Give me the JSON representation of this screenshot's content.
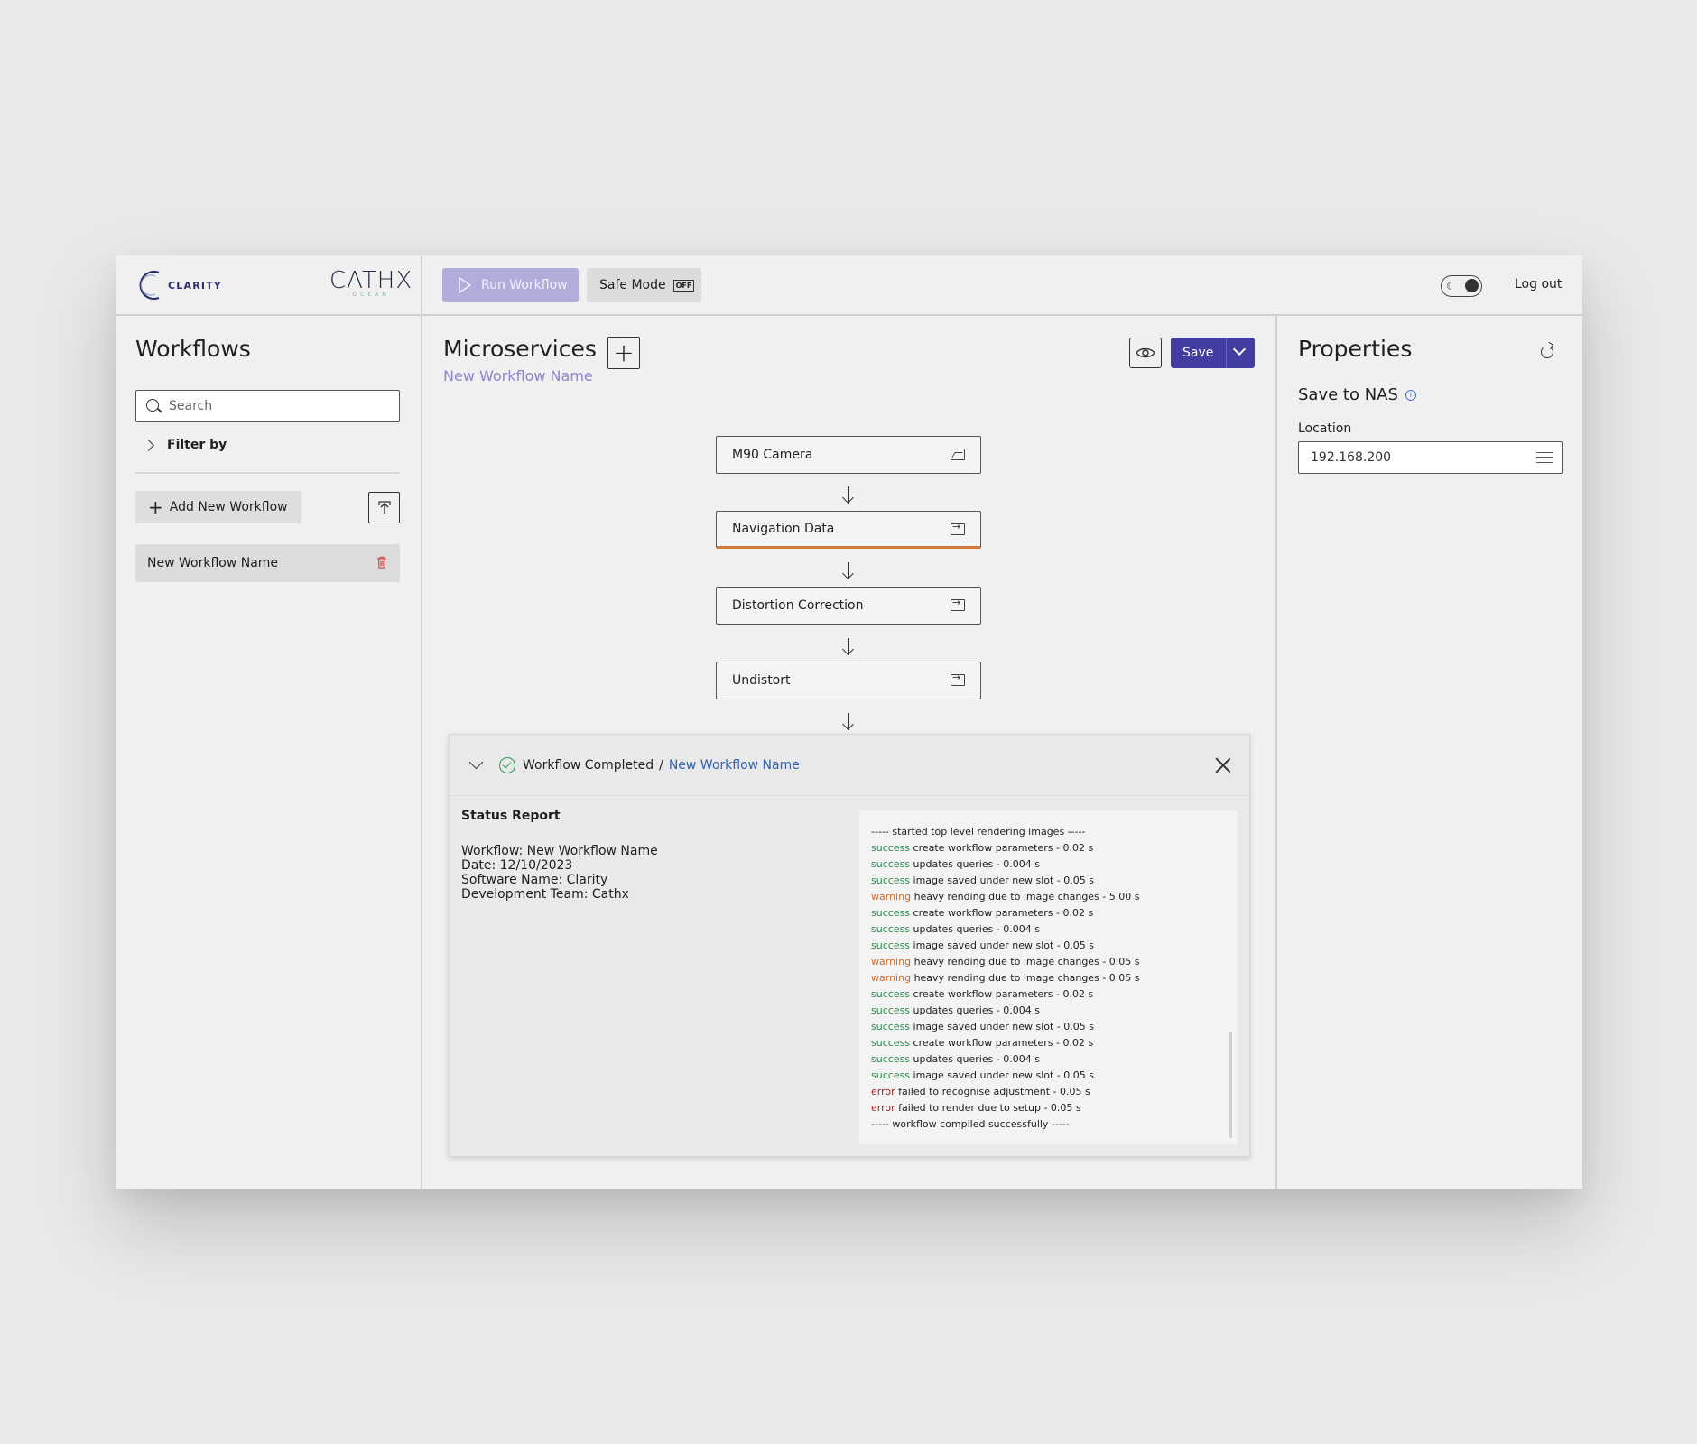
{
  "brand": {
    "product": "CLARITY",
    "company": "CATHX",
    "company_sub": "OCEAN"
  },
  "topbar": {
    "run_label": "Run Workflow",
    "safe_mode_label": "Safe Mode",
    "safe_mode_state": "OFF",
    "logout_label": "Log out",
    "theme_toggle": "dark-mode"
  },
  "sidebar": {
    "title": "Workflows",
    "search_placeholder": "Search",
    "filter_label": "Filter by",
    "add_label": "Add New Workflow",
    "items": [
      {
        "label": "New Workflow Name"
      }
    ]
  },
  "main": {
    "title": "Microservices",
    "workflow_name": "New Workflow Name",
    "save_label": "Save",
    "nodes": [
      {
        "label": "M90 Camera",
        "icon": "image-icon"
      },
      {
        "label": "Navigation Data",
        "icon": "import-icon",
        "active": true
      },
      {
        "label": "Distortion Correction",
        "icon": "import-icon"
      },
      {
        "label": "Undistort",
        "icon": "import-icon"
      }
    ]
  },
  "status": {
    "state": "Workflow Completed",
    "separator": "/",
    "workflow_link": "New Workflow Name",
    "report_title": "Status Report",
    "report_lines": [
      "Workflow: New Workflow Name",
      "Date: 12/10/2023",
      "Software Name: Clarity",
      "Development Team: Cathx"
    ],
    "log": [
      {
        "level": "",
        "text": "----- started top level rendering images -----"
      },
      {
        "level": "success",
        "text": "create workflow parameters - 0.02 s"
      },
      {
        "level": "success",
        "text": "updates queries - 0.004 s"
      },
      {
        "level": "success",
        "text": "image saved under new slot - 0.05 s"
      },
      {
        "level": "warning",
        "text": "heavy rending due to image changes - 5.00 s"
      },
      {
        "level": "success",
        "text": "create workflow parameters - 0.02 s"
      },
      {
        "level": "success",
        "text": "updates queries - 0.004 s"
      },
      {
        "level": "success",
        "text": "image saved under new slot - 0.05 s"
      },
      {
        "level": "warning",
        "text": "heavy rending due to image changes - 0.05 s"
      },
      {
        "level": "warning",
        "text": "heavy rending due to image changes - 0.05 s"
      },
      {
        "level": "success",
        "text": "create workflow parameters - 0.02 s"
      },
      {
        "level": "success",
        "text": "updates queries - 0.004 s"
      },
      {
        "level": "success",
        "text": "image saved under new slot - 0.05 s"
      },
      {
        "level": "success",
        "text": "create workflow parameters - 0.02 s"
      },
      {
        "level": "success",
        "text": "updates queries - 0.004 s"
      },
      {
        "level": "success",
        "text": "image saved under new slot - 0.05 s"
      },
      {
        "level": "error",
        "text": "failed to recognise adjustment - 0.05 s"
      },
      {
        "level": "error",
        "text": "failed to render due to setup - 0.05 s"
      },
      {
        "level": "",
        "text": "----- workflow compiled successfully -----"
      }
    ]
  },
  "properties": {
    "title": "Properties",
    "section": "Save to NAS",
    "location_label": "Location",
    "location_value": "192.168.200"
  },
  "colors": {
    "accent": "#423da0",
    "accent_light": "#b1addb",
    "success": "#2c8a4e",
    "warning": "#c76a2c",
    "error": "#9c1e1e",
    "link": "#2f62b3"
  }
}
